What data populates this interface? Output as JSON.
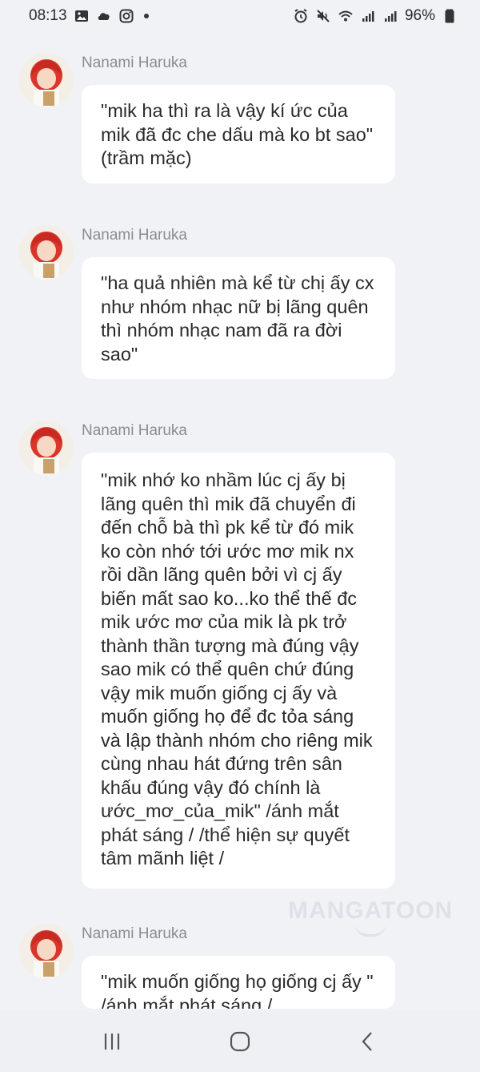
{
  "status_bar": {
    "time": "08:13",
    "battery": "96%",
    "left_icons": [
      "gallery-icon",
      "cloud-icon",
      "instagram-icon",
      "notification-dot-icon"
    ],
    "right_icons": [
      "alarm-icon",
      "mute-icon",
      "wifi-icon",
      "signal-icon",
      "signal-icon",
      "battery-icon"
    ]
  },
  "messages": [
    {
      "sender": "Nanami Haruka",
      "text": "\"mik ha thì ra là vậy kí ức của mik đã đc che dấu mà ko bt sao\" (trầm mặc)"
    },
    {
      "sender": "Nanami Haruka",
      "text": "\"ha quả nhiên mà kể từ chị ấy cx như nhóm nhạc nữ bị lãng quên thì nhóm nhạc nam đã ra đời sao\""
    },
    {
      "sender": "Nanami Haruka",
      "text": "\"mik nhớ ko nhầm lúc cj ấy bị lãng quên thì mik đã chuyển đi đến chỗ bà thì pk kể từ đó mik ko còn nhớ tới ước mơ mik nx rồi dần lãng quên bởi vì cj ấy biến mất sao ko...ko thể thế đc mik ước mơ của mik là pk trở thành thần tượng mà đúng vậy sao mik có thể quên chứ đúng vậy mik muốn giống cj ấy và muốn giống họ để đc tỏa sáng và lập thành nhóm cho riêng mik cùng nhau hát đứng trên sân khấu đúng vậy đó chính là ước_mơ_của_mik\" /ánh mắt phát sáng / /thể hiện sự quyết tâm mãnh liệt /"
    },
    {
      "sender": "Nanami Haruka",
      "text": "\"mik muốn giống họ giống cj ấy \" /ánh mắt phát sáng /"
    }
  ],
  "watermark": "MANGATOON",
  "nav_bar": {
    "buttons": [
      "recent-apps-icon",
      "home-icon",
      "back-icon"
    ]
  }
}
